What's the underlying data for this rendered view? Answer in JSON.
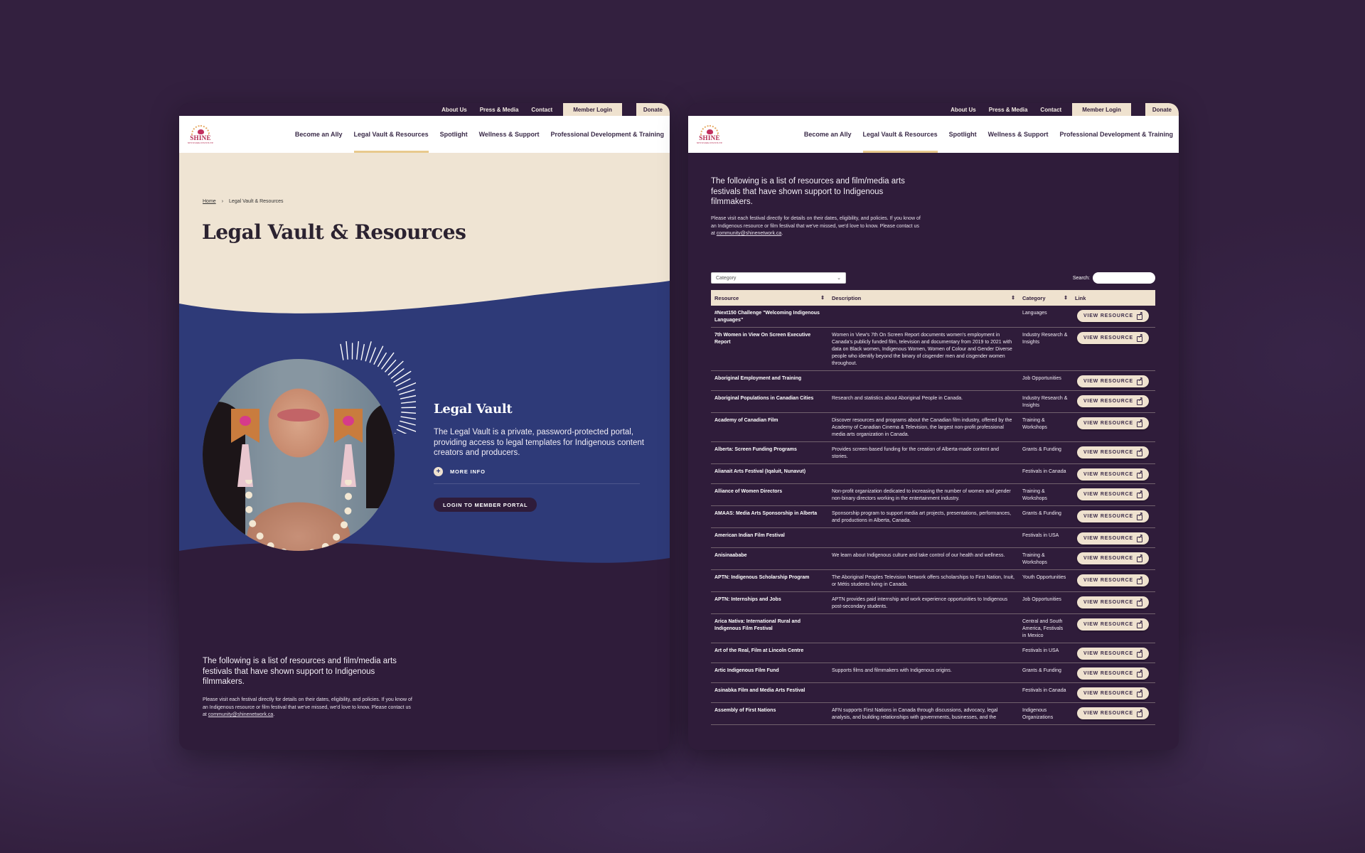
{
  "utility_nav": {
    "links": [
      "About Us",
      "Press & Media",
      "Contact"
    ],
    "member_login": "Member Login",
    "donate": "Donate"
  },
  "logo": {
    "word": "SHINE",
    "sub": "NETWORK INSTITUTE"
  },
  "main_nav": {
    "items": [
      "Become an Ally",
      "Legal Vault & Resources",
      "Spotlight",
      "Wellness & Support",
      "Professional Development & Training"
    ],
    "active_index": 1
  },
  "breadcrumb": {
    "home": "Home",
    "separator": "›",
    "current": "Legal Vault & Resources"
  },
  "page_title": "Legal Vault & Resources",
  "legal_vault": {
    "title": "Legal Vault",
    "description": "The Legal Vault is a private, password-protected portal, providing access to legal templates for Indigenous content creators and producers.",
    "more_info": "MORE INFO",
    "login_button": "LOGIN TO MEMBER PORTAL"
  },
  "intro": {
    "lead": "The following is a list of resources and film/media arts festivals that have shown support to Indigenous filmmakers.",
    "small_before_email": "Please visit each festival directly for details on their dates, eligibility, and policies. If you know of an Indigenous resource or film festival that we've missed, we'd love to know. Please contact us at ",
    "email": "community@shinenetwork.ca",
    "small_after_email": "."
  },
  "filters": {
    "category_placeholder": "Category",
    "search_label": "Search:",
    "search_value": ""
  },
  "table": {
    "headers": [
      "Resource",
      "Description",
      "Category",
      "Link"
    ],
    "button_label": "VIEW RESOURCE",
    "rows": [
      {
        "resource": "#Next150 Challenge \"Welcoming Indigenous Languages\"",
        "description": "",
        "category": "Languages"
      },
      {
        "resource": "7th Women in View On Screen Executive Report",
        "description": "Women in View's 7th On Screen Report documents women's employment in Canada's publicly funded film, television and documentary from 2019 to 2021 with data on Black women, Indigenous Women, Women of Colour and Gender Diverse people who identify beyond the binary of cisgender men and cisgender women throughout.",
        "category": "Industry Research & Insights"
      },
      {
        "resource": "Aboriginal Employment and Training",
        "description": "",
        "category": "Job Opportunities"
      },
      {
        "resource": "Aboriginal Populations in Canadian Cities",
        "description": "Research and statistics about Aboriginal People in Canada.",
        "category": "Industry Research & Insights"
      },
      {
        "resource": "Academy of Canadian Film",
        "description": "Discover resources and programs about the Canadian film industry, offered by the Academy of Canadian Cinema & Television, the largest non-profit professional media arts organization in Canada.",
        "category": "Training & Workshops"
      },
      {
        "resource": "Alberta: Screen Funding Programs",
        "description": "Provides screen-based funding for the creation of Alberta-made content and stories.",
        "category": "Grants & Funding"
      },
      {
        "resource": "Alianait Arts Festival (Iqaluit, Nunavut)",
        "description": "",
        "category": "Festivals in Canada"
      },
      {
        "resource": "Alliance of Women Directors",
        "description": "Non-profit organization dedicated to increasing the number of women and gender non-binary directors working in the entertainment industry.",
        "category": "Training & Workshops"
      },
      {
        "resource": "AMAAS: Media Arts Sponsorship in Alberta",
        "description": "Sponsorship program to support media art projects, presentations, performances, and productions in Alberta, Canada.",
        "category": "Grants & Funding"
      },
      {
        "resource": "American Indian Film Festival",
        "description": "",
        "category": "Festivals in USA"
      },
      {
        "resource": "Anisinaababe",
        "description": "We learn about Indigenous culture and take control of our health and wellness.",
        "category": "Training & Workshops"
      },
      {
        "resource": "APTN: Indigenous Scholarship Program",
        "description": "The Aboriginal Peoples Television Network offers scholarships to First Nation, Inuit, or Métis students living in Canada.",
        "category": "Youth Opportunities"
      },
      {
        "resource": "APTN: Internships and Jobs",
        "description": "APTN provides paid internship and work experience opportunities to Indigenous post-secondary students.",
        "category": "Job Opportunities"
      },
      {
        "resource": "Arica Nativa: International Rural and Indigenous Film Festival",
        "description": "",
        "category": "Central and South America, Festivals in Mexico"
      },
      {
        "resource": "Art of the Real, Film at Lincoln Centre",
        "description": "",
        "category": "Festivals in USA"
      },
      {
        "resource": "Artic Indigenous Film Fund",
        "description": "Supports films and filmmakers with Indigenous origins.",
        "category": "Grants & Funding"
      },
      {
        "resource": "Asinabka Film and Media Arts Festival",
        "description": "",
        "category": "Festivals in Canada"
      },
      {
        "resource": "Assembly of First Nations",
        "description": "AFN supports First Nations in Canada through discussions, advocacy, legal analysis, and building relationships with governments, businesses, and the",
        "category": "Indigenous Organizations"
      }
    ]
  },
  "colors": {
    "background": "#33203f",
    "panel_dark": "#2f1c3a",
    "cream": "#efe4d3",
    "button_cream": "#efe2cf",
    "hero_blue": "#2e3a78",
    "logo_red": "#b2294f",
    "nav_active_underline": "#e8c98d"
  }
}
